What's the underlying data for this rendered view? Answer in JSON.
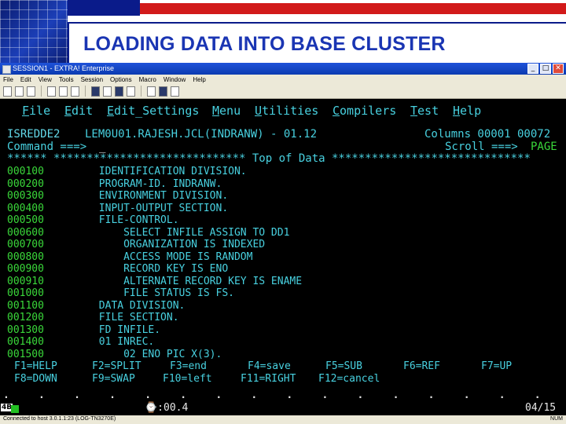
{
  "slide": {
    "title": "LOADING DATA INTO BASE CLUSTER"
  },
  "window": {
    "title": "SESSION1 - EXTRA! Enterprise",
    "buttons": [
      "_",
      "□",
      "✕"
    ]
  },
  "menubar": [
    "File",
    "Edit",
    "View",
    "Tools",
    "Session",
    "Options",
    "Macro",
    "Window",
    "Help"
  ],
  "ispf_menu": {
    "items": [
      {
        "hot": "F",
        "rest": "ile"
      },
      {
        "hot": "E",
        "rest": "dit"
      },
      {
        "hot": "E",
        "rest": "dit_Settings"
      },
      {
        "hot": "M",
        "rest": "enu"
      },
      {
        "hot": "U",
        "rest": "tilities"
      },
      {
        "hot": "C",
        "rest": "ompilers"
      },
      {
        "hot": "T",
        "rest": "est"
      },
      {
        "hot": "H",
        "rest": "elp"
      }
    ]
  },
  "editor": {
    "mode": "ISREDDE2",
    "dataset": "LEM0U01.RAJESH.JCL(INDRANW) - 01.12",
    "columns": "Columns 00001 00072",
    "command_label": "Command ===>",
    "command_value": "_",
    "scroll_label": "Scroll ===>",
    "scroll_value": "PAGE",
    "top_banner": "****** ***************************** Top of Data ******************************",
    "lines": [
      {
        "num": "000100",
        "text": "       IDENTIFICATION DIVISION."
      },
      {
        "num": "000200",
        "text": "       PROGRAM-ID. INDRANW."
      },
      {
        "num": "000300",
        "text": "       ENVIRONMENT DIVISION."
      },
      {
        "num": "000400",
        "text": "       INPUT-OUTPUT SECTION."
      },
      {
        "num": "000500",
        "text": "       FILE-CONTROL."
      },
      {
        "num": "000600",
        "text": "           SELECT INFILE ASSIGN TO DD1"
      },
      {
        "num": "000700",
        "text": "           ORGANIZATION IS INDEXED"
      },
      {
        "num": "000800",
        "text": "           ACCESS MODE IS RANDOM"
      },
      {
        "num": "000900",
        "text": "           RECORD KEY IS ENO"
      },
      {
        "num": "000910",
        "text": "           ALTERNATE RECORD KEY IS ENAME"
      },
      {
        "num": "001000",
        "text": "           FILE STATUS IS FS."
      },
      {
        "num": "001100",
        "text": "       DATA DIVISION."
      },
      {
        "num": "001200",
        "text": "       FILE SECTION."
      },
      {
        "num": "001300",
        "text": "       FD INFILE."
      },
      {
        "num": "001400",
        "text": "       01 INREC."
      },
      {
        "num": "001500",
        "text": "           02 ENO PIC X(3)."
      }
    ]
  },
  "pf_keys": {
    "row1": [
      "F1=HELP",
      "F2=SPLIT",
      "F3=end",
      "F4=save",
      "F5=SUB",
      "F6=REF",
      "F7=UP"
    ],
    "row2": [
      "F8=DOWN",
      "F9=SWAP",
      "F10=left",
      "F11=RIGHT",
      "F12=cancel"
    ]
  },
  "oia": {
    "session": "4B",
    "timer": "⌚:00.4",
    "cursor": "04/15"
  },
  "status": {
    "left": "Connected to host 3.0.1.1:23 (LOG-TN3270E)",
    "right": "NUM"
  },
  "dots": ". . . . . . . . . . . . . . . . . . . . . . . . . . ."
}
